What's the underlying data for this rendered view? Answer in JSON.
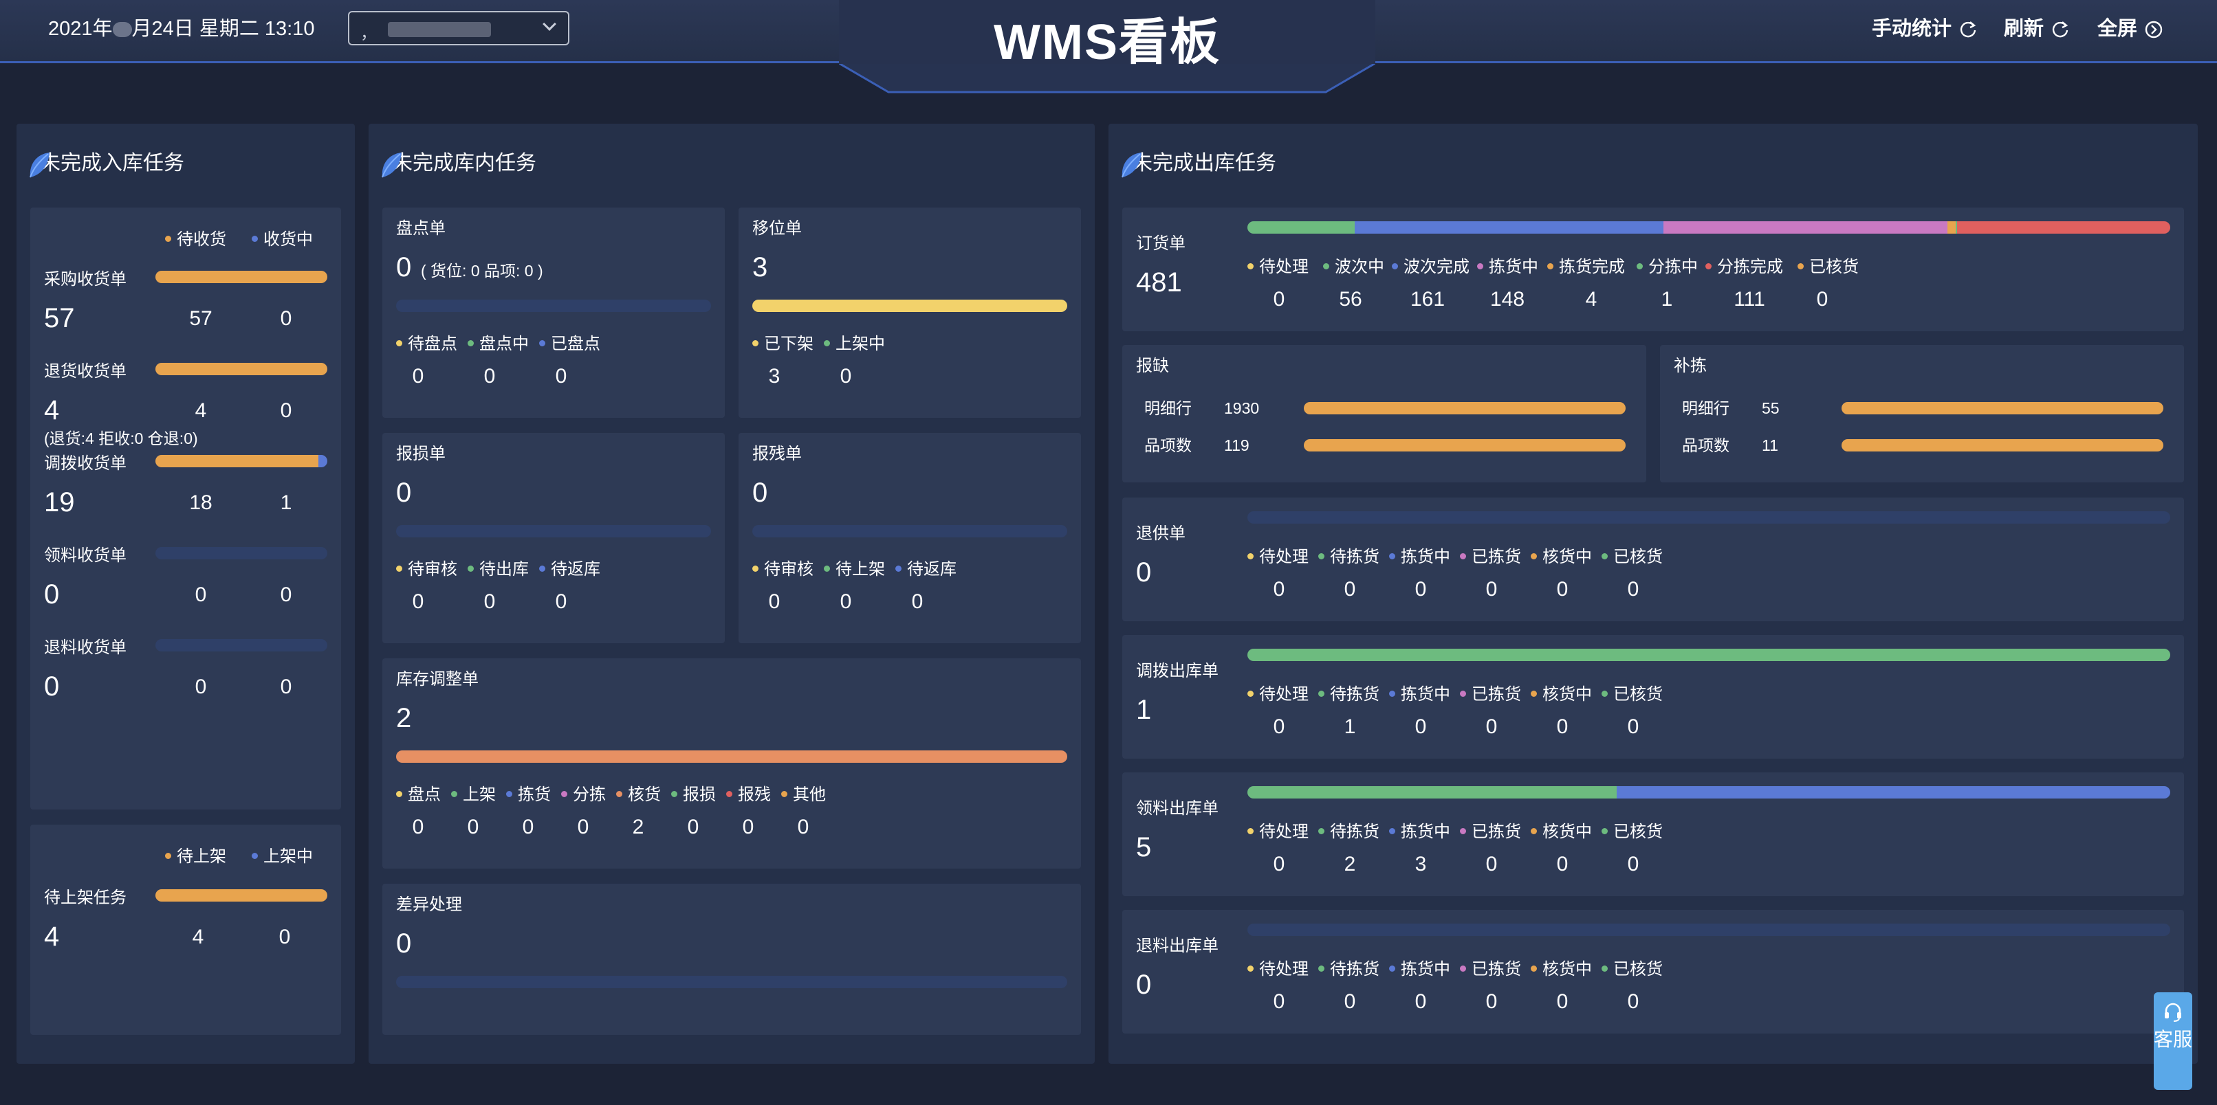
{
  "header": {
    "date_prefix": "2021年",
    "date_suffix": "月24日 星期二 13:10",
    "warehouse_value": "，",
    "title": "WMS看板",
    "manual_stats": "手动统计",
    "refresh": "刷新",
    "fullscreen": "全屏"
  },
  "colors": {
    "orange": "#e8a44e",
    "blue": "#5b7ad6",
    "green": "#6dbb7f",
    "pink": "#c979c2",
    "red": "#e0605f",
    "yellow": "#f2d26b",
    "salmon": "#e79063",
    "empty": "#2f4068"
  },
  "inbound": {
    "title": "未完成入库任务",
    "legend": [
      "待收货",
      "收货中"
    ],
    "rows": [
      {
        "label": "采购收货单",
        "total": "57",
        "a": "57",
        "b": "0",
        "a_frac": 1.0,
        "note": ""
      },
      {
        "label": "退货收货单",
        "total": "4",
        "a": "4",
        "b": "0",
        "a_frac": 1.0,
        "note": "(退货:4 拒收:0 仓退:0)"
      },
      {
        "label": "调拨收货单",
        "total": "19",
        "a": "18",
        "b": "1",
        "a_frac": 0.947,
        "note": ""
      },
      {
        "label": "领料收货单",
        "total": "0",
        "a": "0",
        "b": "0",
        "a_frac": 0,
        "note": ""
      },
      {
        "label": "退料收货单",
        "total": "0",
        "a": "0",
        "b": "0",
        "a_frac": 0,
        "note": ""
      }
    ],
    "putaway": {
      "legend": [
        "待上架",
        "上架中"
      ],
      "label": "待上架任务",
      "total": "4",
      "a": "4",
      "b": "0",
      "a_frac": 1.0
    }
  },
  "warehouse": {
    "title": "未完成库内任务",
    "stocktake": {
      "label": "盘点单",
      "total": "0",
      "detail": "( 货位: 0  品项: 0 )",
      "legend": [
        "待盘点",
        "盘点中",
        "已盘点"
      ],
      "values": [
        "0",
        "0",
        "0"
      ]
    },
    "move": {
      "label": "移位单",
      "total": "3",
      "legend": [
        "已下架",
        "上架中"
      ],
      "values": [
        "3",
        "0"
      ]
    },
    "damage": {
      "label": "报损单",
      "total": "0",
      "legend": [
        "待审核",
        "待出库",
        "待返库"
      ],
      "values": [
        "0",
        "0",
        "0"
      ]
    },
    "defect": {
      "label": "报残单",
      "total": "0",
      "legend": [
        "待审核",
        "待上架",
        "待返库"
      ],
      "values": [
        "0",
        "0",
        "0"
      ]
    },
    "adjust": {
      "label": "库存调整单",
      "total": "2",
      "legend": [
        "盘点",
        "上架",
        "拣货",
        "分拣",
        "核货",
        "报损",
        "报残",
        "其他"
      ],
      "values": [
        "0",
        "0",
        "0",
        "0",
        "2",
        "0",
        "0",
        "0"
      ]
    },
    "diff": {
      "label": "差异处理",
      "total": "0"
    }
  },
  "outbound": {
    "title": "未完成出库任务",
    "order": {
      "label": "订货单",
      "total": "481",
      "legend": [
        "待处理",
        "波次中",
        "波次完成",
        "拣货中",
        "拣货完成",
        "分拣中",
        "分拣完成",
        "已核货"
      ],
      "values": [
        "0",
        "56",
        "161",
        "148",
        "4",
        "1",
        "111",
        "0"
      ]
    },
    "shortage": {
      "label": "报缺",
      "rows": [
        {
          "label": "明细行",
          "value": "1930"
        },
        {
          "label": "品项数",
          "value": "119"
        }
      ]
    },
    "replenish": {
      "label": "补拣",
      "rows": [
        {
          "label": "明细行",
          "value": "55"
        },
        {
          "label": "品项数",
          "value": "11"
        }
      ]
    },
    "status_legend": [
      "待处理",
      "待拣货",
      "拣货中",
      "已拣货",
      "核货中",
      "已核货"
    ],
    "sections": [
      {
        "label": "退供单",
        "total": "0",
        "values": [
          "0",
          "0",
          "0",
          "0",
          "0",
          "0"
        ]
      },
      {
        "label": "调拨出库单",
        "total": "1",
        "values": [
          "0",
          "1",
          "0",
          "0",
          "0",
          "0"
        ]
      },
      {
        "label": "领料出库单",
        "total": "5",
        "values": [
          "0",
          "2",
          "3",
          "0",
          "0",
          "0"
        ]
      },
      {
        "label": "退料出库单",
        "total": "0",
        "values": [
          "0",
          "0",
          "0",
          "0",
          "0",
          "0"
        ]
      }
    ]
  },
  "service": {
    "label": "客服"
  }
}
